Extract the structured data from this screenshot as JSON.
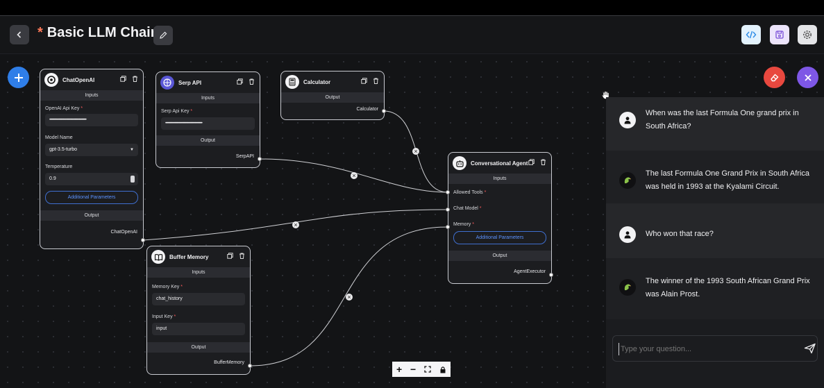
{
  "header": {
    "title": "Basic LLM Chain",
    "unsaved_marker": "*"
  },
  "nodes": {
    "chatopenai": {
      "title": "ChatOpenAI",
      "inputs_label": "Inputs",
      "api_key_label": "OpenAI Api Key",
      "api_key_value": "••••••••••••••••••••••••••••••••••••••••••••••••",
      "model_label": "Model Name",
      "model_value": "gpt-3.5-turbo",
      "temperature_label": "Temperature",
      "temperature_value": "0.9",
      "additional_label": "Additional Parameters",
      "output_label": "Output",
      "output_port": "ChatOpenAI"
    },
    "serp": {
      "title": "Serp API",
      "inputs_label": "Inputs",
      "api_key_label": "Serp Api Key",
      "api_key_value": "••••••••••••••••••••••••••••••••••••••••••••••••",
      "output_label": "Output",
      "output_port": "SerpAPI"
    },
    "calculator": {
      "title": "Calculator",
      "output_label": "Output",
      "output_port": "Calculator"
    },
    "agent": {
      "title": "Conversational Agent",
      "inputs_label": "Inputs",
      "tools_label": "Allowed Tools",
      "model_label": "Chat Model",
      "memory_label": "Memory",
      "additional_label": "Additional Parameters",
      "output_label": "Output",
      "output_port": "AgentExecutor"
    },
    "memory": {
      "title": "Buffer Memory",
      "inputs_label": "Inputs",
      "memory_key_label": "Memory Key",
      "memory_key_value": "chat_history",
      "input_key_label": "Input Key",
      "input_key_value": "input",
      "output_label": "Output",
      "output_port": "BufferMemory"
    }
  },
  "chat": {
    "messages": [
      {
        "role": "user",
        "text": "When was the last Formula One grand prix in South Africa?"
      },
      {
        "role": "bot",
        "text": "The last Formula One Grand Prix in South Africa was held in 1993 at the Kyalami Circuit."
      },
      {
        "role": "user",
        "text": "Who won that race?"
      },
      {
        "role": "bot",
        "text": "The winner of the 1993 South African Grand Prix was Alain Prost."
      }
    ],
    "input_placeholder": "Type your question..."
  },
  "colors": {
    "add_button": "#2f7ee8",
    "clear_button": "#e8483f",
    "close_button": "#7e57e6",
    "required": "#ff5c5c",
    "link": "#5c93ff"
  },
  "controls": {
    "zoom_in": "+",
    "zoom_out": "−"
  }
}
